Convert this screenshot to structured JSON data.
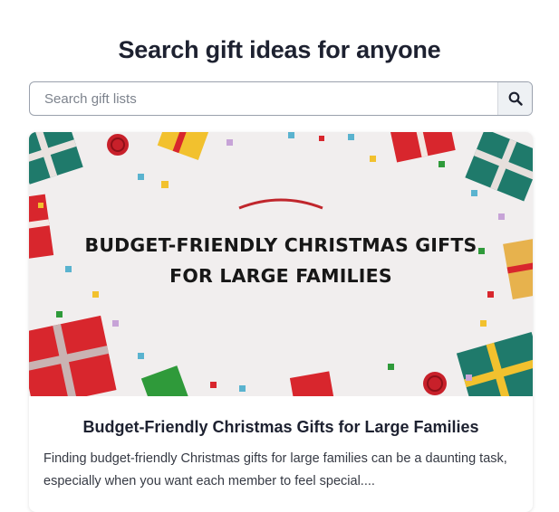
{
  "page": {
    "title": "Search gift ideas for anyone"
  },
  "search": {
    "placeholder": "Search gift lists",
    "button_icon": "search-icon"
  },
  "card": {
    "image_heading_line1": "BUDGET-FRIENDLY CHRISTMAS GIFTS",
    "image_heading_line2": "FOR LARGE FAMILIES",
    "title": "Budget-Friendly Christmas Gifts for Large Families",
    "description": "Finding budget-friendly Christmas gifts for large families can be a daunting task, especially when you want each member to feel special...."
  },
  "colors": {
    "background": "#ffffff",
    "image_background": "#f1eeee",
    "gift_red": "#d8262d",
    "gift_teal": "#1f7a6b",
    "gift_yellow": "#f2c12e",
    "accent_arc": "#c0262c"
  }
}
